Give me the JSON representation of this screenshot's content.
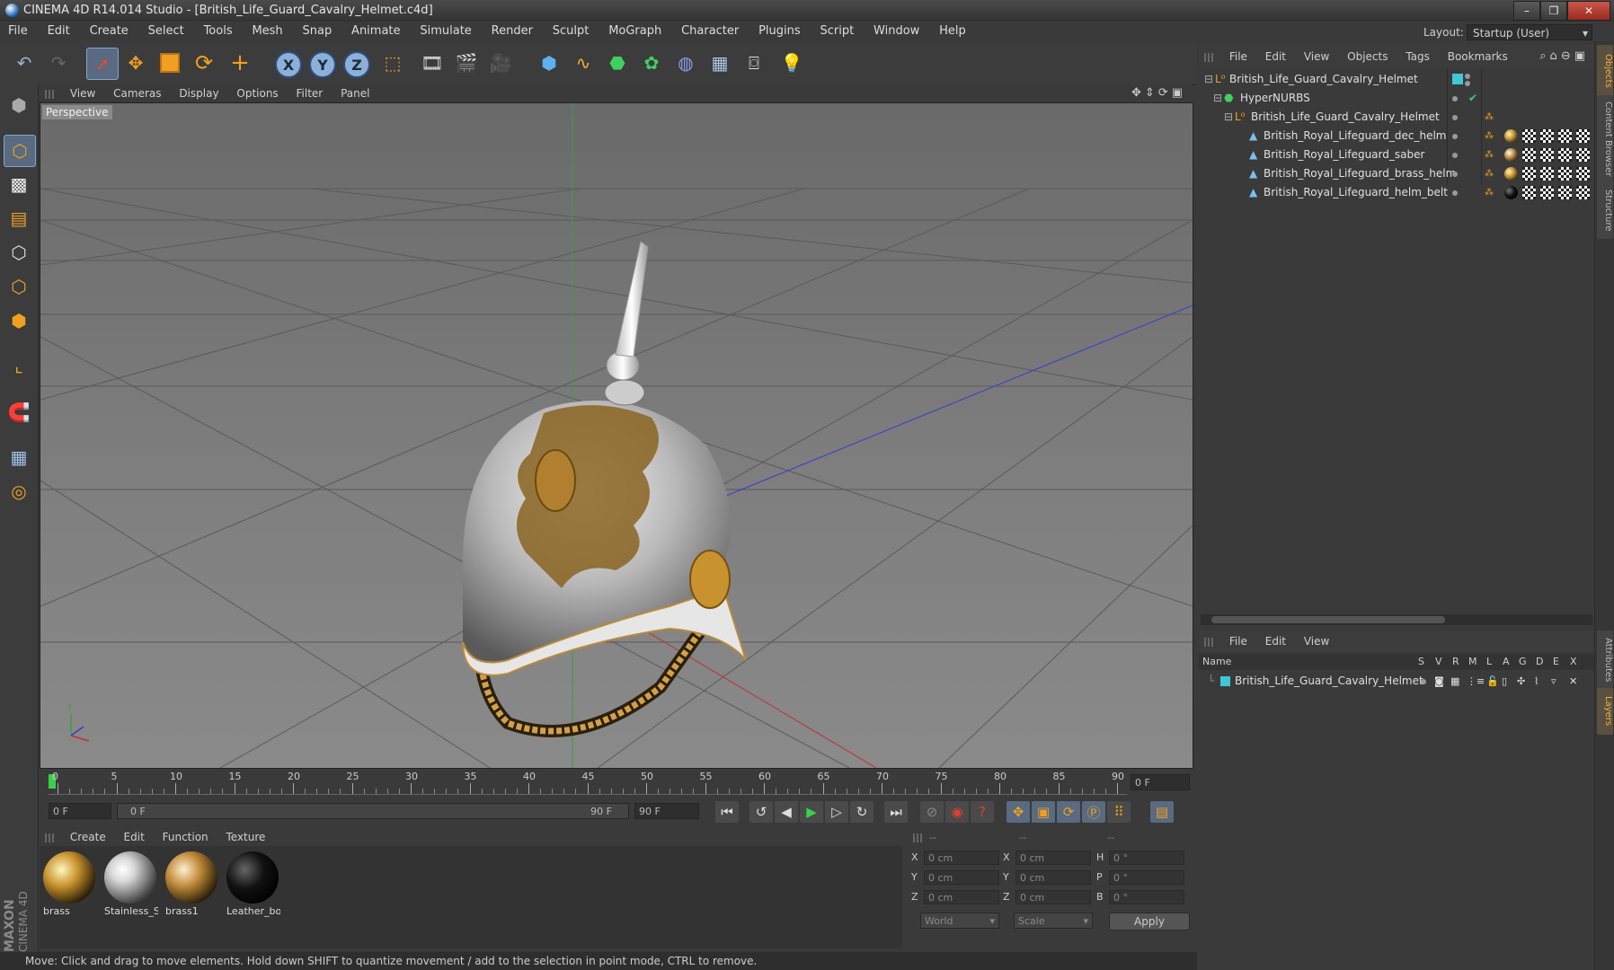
{
  "window": {
    "title": "CINEMA 4D R14.014 Studio - [British_Life_Guard_Cavalry_Helmet.c4d]",
    "minimize": "–",
    "restore": "❐",
    "close": "✕"
  },
  "menu": [
    "File",
    "Edit",
    "Create",
    "Select",
    "Tools",
    "Mesh",
    "Snap",
    "Animate",
    "Simulate",
    "Render",
    "Sculpt",
    "MoGraph",
    "Character",
    "Plugins",
    "Script",
    "Window",
    "Help"
  ],
  "layout": {
    "label": "Layout:",
    "value": "Startup (User)"
  },
  "toolbar": {
    "icons": [
      "undo-icon",
      "redo-icon",
      "live-select-icon",
      "move-icon",
      "scale-icon",
      "rotate-icon",
      "add-icon",
      "x-axis-icon",
      "y-axis-icon",
      "z-axis-icon",
      "coordinate-system-icon",
      "render-view-icon",
      "render-picture-viewer-icon",
      "render-settings-icon",
      "cube-icon",
      "spline-icon",
      "nurbs-icon",
      "array-icon",
      "deformer-icon",
      "floor-icon",
      "camera-icon",
      "light-icon"
    ],
    "axis_x": "X",
    "axis_y": "Y",
    "axis_z": "Z"
  },
  "viewport": {
    "menu": [
      "View",
      "Cameras",
      "Display",
      "Options",
      "Filter",
      "Panel"
    ],
    "label": "Perspective"
  },
  "timeline": {
    "ticks": [
      "0",
      "5",
      "10",
      "15",
      "20",
      "25",
      "30",
      "35",
      "40",
      "45",
      "50",
      "55",
      "60",
      "65",
      "70",
      "75",
      "80",
      "85",
      "90"
    ],
    "current_frame": "0 F"
  },
  "transport": {
    "start": "0 F",
    "range_start": "0 F",
    "range_end": "90 F",
    "end": "90 F"
  },
  "materials": {
    "menu": [
      "Create",
      "Edit",
      "Function",
      "Texture"
    ],
    "items": [
      {
        "name": "brass",
        "color": "#c8922e"
      },
      {
        "name": "Stainless_S",
        "color": "#d8d8d8"
      },
      {
        "name": "brass1",
        "color": "#c08a3a"
      },
      {
        "name": "Leather_bo",
        "color": "#111111"
      }
    ]
  },
  "coords": {
    "headers": [
      "--",
      "--",
      "--"
    ],
    "rows": [
      {
        "a": "X",
        "av": "0 cm",
        "b": "X",
        "bv": "0 cm",
        "c": "H",
        "cv": "0 °"
      },
      {
        "a": "Y",
        "av": "0 cm",
        "b": "Y",
        "bv": "0 cm",
        "c": "P",
        "cv": "0 °"
      },
      {
        "a": "Z",
        "av": "0 cm",
        "b": "Z",
        "bv": "0 cm",
        "c": "B",
        "cv": "0 °"
      }
    ],
    "world": "World",
    "scale": "Scale",
    "apply": "Apply"
  },
  "status": "Move: Click and drag to move elements. Hold down SHIFT to quantize movement / add to the selection in point mode, CTRL to remove.",
  "brand": {
    "line1": "MAXON",
    "line2": "CINEMA 4D"
  },
  "objects": {
    "menu": [
      "File",
      "Edit",
      "View",
      "Objects",
      "Tags",
      "Bookmarks"
    ],
    "items": [
      {
        "name": "British_Life_Guard_Cavalry_Helmet",
        "indent": 0
      },
      {
        "name": "HyperNURBS",
        "indent": 1
      },
      {
        "name": "British_Life_Guard_Cavalry_Helmet",
        "indent": 2
      },
      {
        "name": "British_Royal_Lifeguard_dec_helm",
        "indent": 3
      },
      {
        "name": "British_Royal_Lifeguard_saber",
        "indent": 3
      },
      {
        "name": "British_Royal_Lifeguard_brass_helm",
        "indent": 3
      },
      {
        "name": "British_Royal_Lifeguard_helm_belt",
        "indent": 3
      }
    ]
  },
  "layers": {
    "menu": [
      "File",
      "Edit",
      "View"
    ],
    "columns": [
      "Name",
      "S",
      "V",
      "R",
      "M",
      "L",
      "A",
      "G",
      "D",
      "E",
      "X"
    ],
    "items": [
      {
        "name": "British_Life_Guard_Cavalry_Helmet",
        "color": "#3fc7d8"
      }
    ]
  },
  "right_tabs": [
    "Objects",
    "Content Browser",
    "Structure",
    "Attributes",
    "Layers"
  ]
}
